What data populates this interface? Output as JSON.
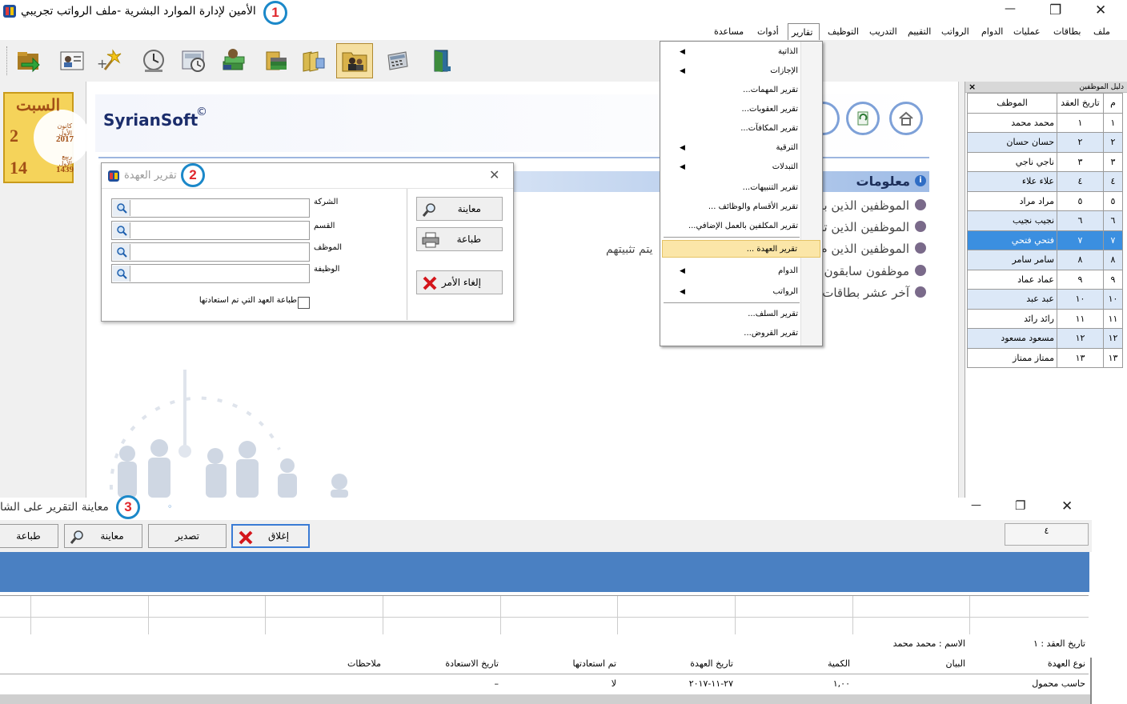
{
  "window": {
    "title": "الأمين لإدارة الموارد البشرية -ملف الرواتب تجريبي",
    "minimize": "—",
    "maximize": "❐",
    "close": "✕"
  },
  "markers": [
    "1",
    "2",
    "3"
  ],
  "menubar": [
    {
      "label": "ملف"
    },
    {
      "label": "بطاقات"
    },
    {
      "label": "عمليات"
    },
    {
      "label": "الدوام"
    },
    {
      "label": "الرواتب"
    },
    {
      "label": "التقييم"
    },
    {
      "label": "التدريب"
    },
    {
      "label": "التوظيف"
    },
    {
      "label": "تقارير",
      "active": true
    },
    {
      "label": "أدوات"
    },
    {
      "label": "مساعدة"
    }
  ],
  "reports_menu": {
    "items": [
      {
        "label": "الذاتية",
        "submenu": true
      },
      {
        "label": "الإجازات",
        "submenu": true
      },
      {
        "label": "تقرير المهمات...",
        "submenu": false
      },
      {
        "label": "تقرير العقوبات...",
        "submenu": false
      },
      {
        "label": "تقرير المكافآت...",
        "submenu": false
      },
      {
        "label": "الترقية",
        "submenu": true
      },
      {
        "label": "التبدلات",
        "submenu": true
      },
      {
        "label": "تقرير التنبيهات...",
        "submenu": false
      },
      {
        "label": "تقرير الأقسام والوظائف ...",
        "submenu": false
      },
      {
        "label": "تقرير المكلفين بالعمل الإضافي...",
        "submenu": false
      },
      {
        "label": "تقرير العهدة ...",
        "submenu": false,
        "highlighted": true
      },
      {
        "label": "الدوام",
        "submenu": true
      },
      {
        "label": "الرواتب",
        "submenu": true
      },
      {
        "label": "تقرير السلف...",
        "submenu": false
      },
      {
        "label": "تقرير القروض...",
        "submenu": false
      }
    ],
    "arrow": "◀"
  },
  "calendar": {
    "day_name": "السبت",
    "day1": "2",
    "month1": "كانون الأول",
    "year1": "2017",
    "day2": "14",
    "month2": "ربيع الأول",
    "year2": "1439"
  },
  "brand": {
    "name": "SyrianSoft",
    "mark": "©"
  },
  "info": {
    "header": "معلومات",
    "lines": [
      "الموظفين الذين با",
      "الموظفين الذين تم",
      "الموظفين الذين م",
      "موظفون سابقون",
      "آخر عشر بطاقات ل"
    ],
    "stray_text": "يتم تثبيتهم"
  },
  "employee_list": {
    "title": "دليل الموظفين",
    "close": "×",
    "columns": [
      "م",
      "تاريخ العقد",
      "الموظف"
    ],
    "rows": [
      {
        "n": "١",
        "date": "١",
        "name": "محمد محمد"
      },
      {
        "n": "٢",
        "date": "٢",
        "name": "حسان حسان"
      },
      {
        "n": "٣",
        "date": "٣",
        "name": "ناجي ناجي"
      },
      {
        "n": "٤",
        "date": "٤",
        "name": "علاء علاء"
      },
      {
        "n": "٥",
        "date": "٥",
        "name": "مراد مراد"
      },
      {
        "n": "٦",
        "date": "٦",
        "name": "نجيب نجيب"
      },
      {
        "n": "٧",
        "date": "٧",
        "name": "فتحي فتحي"
      },
      {
        "n": "٨",
        "date": "٨",
        "name": "سامر سامر"
      },
      {
        "n": "٩",
        "date": "٩",
        "name": "عماد عماد"
      },
      {
        "n": "١٠",
        "date": "١٠",
        "name": "عبد عبد"
      },
      {
        "n": "١١",
        "date": "١١",
        "name": "رائد رائد"
      },
      {
        "n": "١٢",
        "date": "١٢",
        "name": "مسعود مسعود"
      },
      {
        "n": "١٣",
        "date": "١٣",
        "name": "ممتاز ممتاز"
      }
    ],
    "selected_index": 6
  },
  "custody_dialog": {
    "title": "تقرير العهدة",
    "close": "✕",
    "fields": [
      {
        "label": "الشركة",
        "value": ""
      },
      {
        "label": "القسم",
        "value": ""
      },
      {
        "label": "الموظف",
        "value": ""
      },
      {
        "label": "الوظيفة",
        "value": ""
      }
    ],
    "checkbox_label": "طباعة العهد التي تم استعادتها",
    "buttons": {
      "preview": "معاينة",
      "print": "طباعة",
      "cancel": "إلغاء الأمر"
    }
  },
  "preview_window": {
    "title": "معاينة التقرير على الشا",
    "dot": "◦",
    "buttons": {
      "print": "طباعة",
      "preview": "معاينة",
      "export": "تصدير",
      "close": "إغلاق"
    },
    "page_field": "٤",
    "report": {
      "contract_date_label": "تاريخ العقد : ١",
      "name_label": "الاسم : محمد محمد",
      "columns": [
        "نوع العهدة",
        "البيان",
        "الكمية",
        "تاريخ العهدة",
        "تم استعادتها",
        "تاريخ الاستعادة",
        "ملاحظات"
      ],
      "row": {
        "type": "حاسب محمول",
        "desc": "",
        "qty": "١,٠٠",
        "date": "٢٧-١١-٢٠١٧",
        "returned": "لا",
        "return_date": "–",
        "notes": ""
      }
    }
  }
}
